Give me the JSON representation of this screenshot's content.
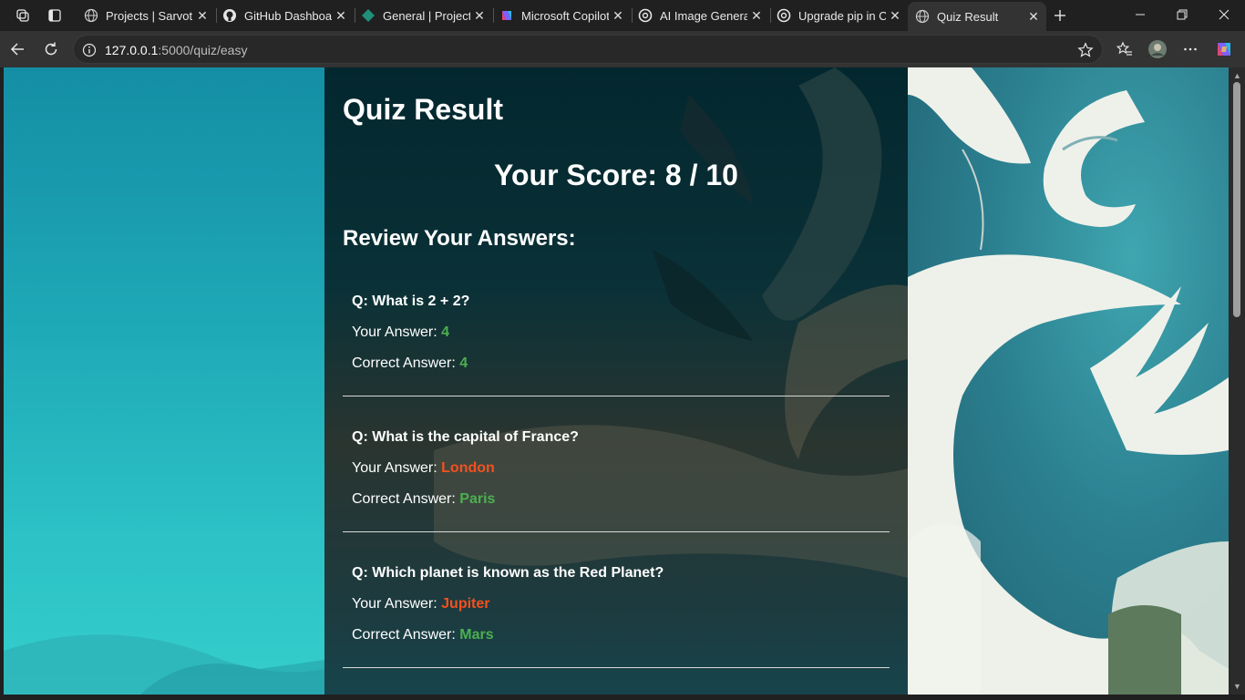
{
  "browser": {
    "tabs": [
      {
        "label": "Projects | Sarvoth",
        "icon": "globe-icon"
      },
      {
        "label": "GitHub Dashboard",
        "icon": "github-icon"
      },
      {
        "label": "General | Project",
        "icon": "teams-icon"
      },
      {
        "label": "Microsoft Copilot",
        "icon": "copilot-icon"
      },
      {
        "label": "AI Image Generat",
        "icon": "openai-icon"
      },
      {
        "label": "Upgrade pip in C",
        "icon": "openai-icon"
      },
      {
        "label": "Quiz Result",
        "icon": "globe-icon",
        "active": true
      }
    ],
    "url_host": "127.0.0.1",
    "url_path": ":5000/quiz/easy"
  },
  "page": {
    "title": "Quiz Result",
    "score_text": "Your Score: 8 / 10",
    "review_heading": "Review Your Answers:",
    "your_answer_label": "Your Answer:",
    "correct_answer_label": "Correct Answer:",
    "questions": [
      {
        "question": "Q: What is 2 + 2?",
        "your_answer": "4",
        "correct_answer": "4",
        "is_correct": true
      },
      {
        "question": "Q: What is the capital of France?",
        "your_answer": "London",
        "correct_answer": "Paris",
        "is_correct": false
      },
      {
        "question": "Q: Which planet is known as the Red Planet?",
        "your_answer": "Jupiter",
        "correct_answer": "Mars",
        "is_correct": false
      }
    ]
  },
  "colors": {
    "correct": "#4caf50",
    "wrong": "#f4511e"
  }
}
